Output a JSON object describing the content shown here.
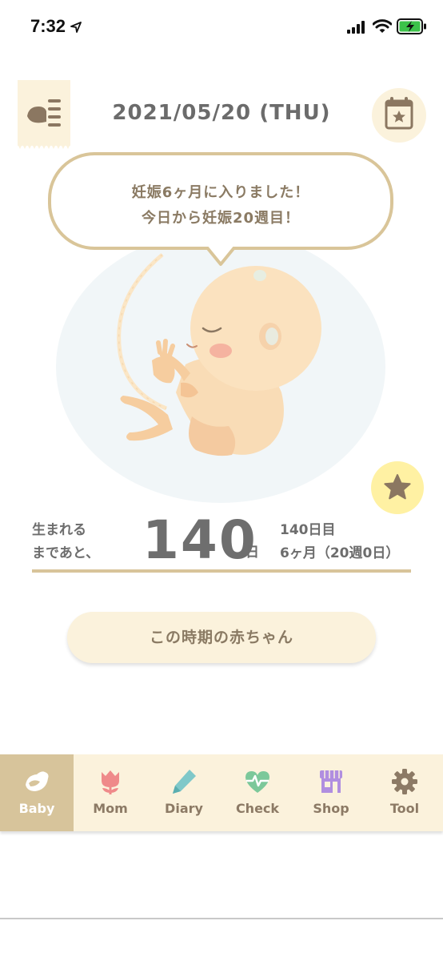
{
  "status_bar": {
    "time": "7:32"
  },
  "header": {
    "date": "2021/05/20 (THU)"
  },
  "bubble": {
    "line1": "妊娠6ヶ月に入りました！",
    "line2": "今日から妊娠20週目！"
  },
  "countdown": {
    "label_line1": "生まれる",
    "label_line2": "まであと、",
    "days_remaining": "140",
    "unit": "日",
    "day_count": "140日目",
    "month_week": "6ヶ月（20週0日）"
  },
  "main": {
    "this_period_label": "この時期の赤ちゃん"
  },
  "tabs": [
    {
      "label": "Baby",
      "icon": "bird-icon",
      "active": true
    },
    {
      "label": "Mom",
      "icon": "tulip-icon",
      "active": false
    },
    {
      "label": "Diary",
      "icon": "pencil-icon",
      "active": false
    },
    {
      "label": "Check",
      "icon": "heart-pulse-icon",
      "active": false
    },
    {
      "label": "Shop",
      "icon": "store-icon",
      "active": false
    },
    {
      "label": "Tool",
      "icon": "gear-icon",
      "active": false
    }
  ],
  "colors": {
    "accent_beige": "#d7c49b",
    "light_beige": "#fbf2dc",
    "star_yellow": "#fff1a3",
    "tab_text": "#8c7a65"
  }
}
